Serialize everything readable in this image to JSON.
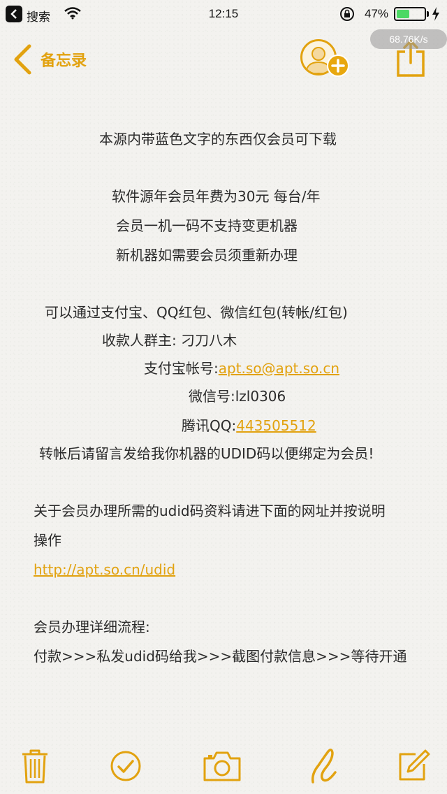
{
  "status_bar": {
    "app_label": "搜索",
    "time": "12:15",
    "battery_percent": "47%",
    "battery_level": 0.47,
    "net_speed": "68.76K/s"
  },
  "nav": {
    "back_label": "备忘录"
  },
  "note": {
    "line1": "本源内带蓝色文字的东西仅会员可下载",
    "line2": "软件源年会员年费为30元 每台/年",
    "line3": "会员一机一码不支持变更机器",
    "line4": "新机器如需要会员须重新办理",
    "line5": "可以通过支付宝、QQ红包、微信红包(转帐/红包)",
    "line6": "收款人群主: 刁刀八木",
    "alipay_label": "支付宝帐号:",
    "alipay_value": "apt.so@apt.so.cn",
    "wechat_label": "微信号:",
    "wechat_value": "lzl0306",
    "qq_label": "腾讯QQ:",
    "qq_value": "443505512",
    "line10": "转帐后请留言发给我你机器的UDID码以便绑定为会员!",
    "line11": "关于会员办理所需的udid码资料请进下面的网址并按说明",
    "line12": "操作",
    "url": "http://apt.so.cn/udid",
    "line14": "会员办理详细流程:",
    "line15": "付款>>>私发udid码给我>>>截图付款信息>>>等待开通"
  },
  "toolbar": {
    "items": [
      "trash",
      "checklist",
      "camera",
      "sketch",
      "compose"
    ]
  },
  "colors": {
    "accent": "#e2a20f",
    "battery": "#4cd964"
  }
}
